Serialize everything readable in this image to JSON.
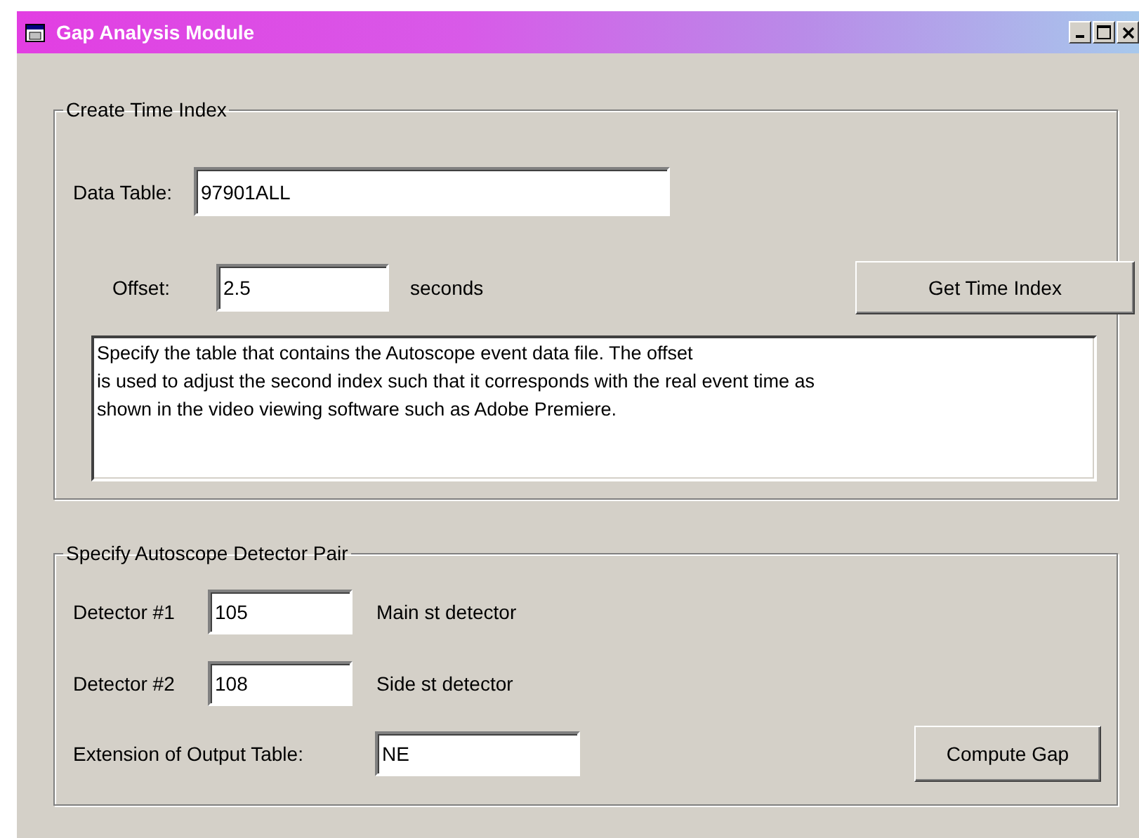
{
  "window": {
    "title": "Gap Analysis Module"
  },
  "time_index": {
    "title": "Create Time Index",
    "data_table": {
      "label": "Data Table:",
      "value": "97901ALL"
    },
    "offset": {
      "label": "Offset:",
      "value": "2.5",
      "unit": "seconds"
    },
    "button": "Get Time Index",
    "description": "Specify the table that contains the Autoscope event data file. The offset\nis used to adjust the second index such that it corresponds with the real event time as\nshown in the video viewing software such as Adobe Premiere."
  },
  "detector_pair": {
    "title": "Specify Autoscope Detector Pair",
    "detectors": [
      {
        "label": "Detector #1",
        "value": "105",
        "note": "Main st detector"
      },
      {
        "label": "Detector #2",
        "value": "108",
        "note": "Side st detector"
      }
    ],
    "extension": {
      "label": "Extension of Output Table:",
      "value": "NE"
    },
    "button": "Compute Gap"
  }
}
